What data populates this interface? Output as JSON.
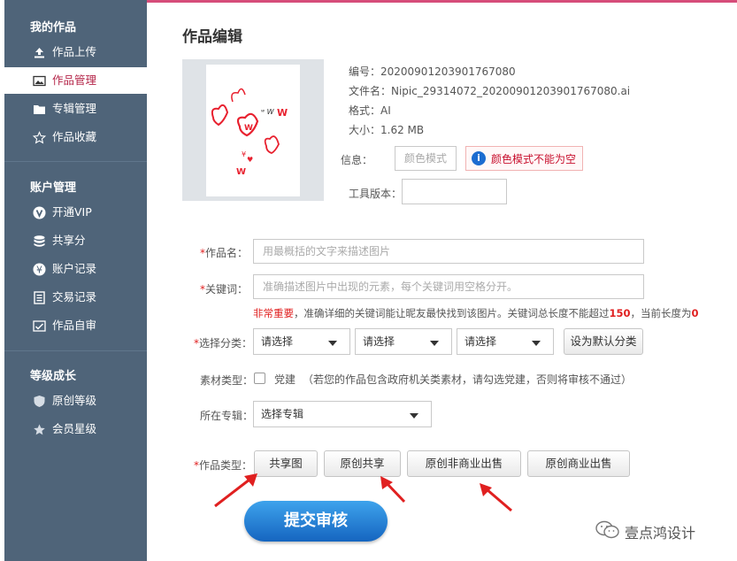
{
  "sidebar": {
    "sections": [
      {
        "title": "我的作品",
        "items": [
          {
            "label": "作品上传",
            "icon": "upload-icon"
          },
          {
            "label": "作品管理",
            "icon": "image-icon",
            "active": true
          },
          {
            "label": "专辑管理",
            "icon": "folder-icon"
          },
          {
            "label": "作品收藏",
            "icon": "star-outline-icon"
          }
        ]
      },
      {
        "title": "账户管理",
        "items": [
          {
            "label": "开通VIP",
            "icon": "vip-icon"
          },
          {
            "label": "共享分",
            "icon": "database-icon"
          },
          {
            "label": "账户记录",
            "icon": "yen-icon"
          },
          {
            "label": "交易记录",
            "icon": "ledger-icon"
          },
          {
            "label": "作品自审",
            "icon": "image-check-icon"
          }
        ]
      },
      {
        "title": "等级成长",
        "items": [
          {
            "label": "原创等级",
            "icon": "shield-icon"
          },
          {
            "label": "会员星级",
            "icon": "star-icon"
          }
        ]
      }
    ]
  },
  "page": {
    "title": "作品编辑"
  },
  "meta": {
    "id": "编号：20200901203901767080",
    "filename": "文件名：Nipic_29314072_20200901203901767080.ai",
    "format": "格式：AI",
    "size": "大小：1.62 MB",
    "info_label": "信息：",
    "color_mode_placeholder": "颜色模式",
    "error_text": "颜色模式不能为空",
    "tool_version_label": "工具版本："
  },
  "form": {
    "name_label": "作品名：",
    "name_placeholder": "用最概括的文字来描述图片",
    "keywords_label": "关键词：",
    "keywords_placeholder": "准确描述图片中出现的元素，每个关键词用空格分开。",
    "hint_important": "非常重要",
    "hint_text": "，准确详细的关键词能让昵友最快找到该图片。关键词总长度不能超过",
    "hint_max": "150",
    "hint_text2": "，当前长度为",
    "hint_current": "0",
    "category_label": "选择分类：",
    "category_selects": [
      "请选择",
      "请选择",
      "请选择"
    ],
    "default_category_button": "设为默认分类",
    "material_label": "素材类型：",
    "material_checkbox_label": "党建",
    "material_note": "（若您的作品包含政府机关类素材，请勾选党建，否则将审核不通过）",
    "album_label": "所在专辑：",
    "album_select": "选择专辑",
    "type_label": "作品类型：",
    "type_buttons": [
      "共享图",
      "原创共享",
      "原创非商业出售",
      "原创商业出售"
    ],
    "submit": "提交审核"
  },
  "watermark": "壹点鸿设计",
  "colors": {
    "sidebar_bg": "#4f6479",
    "accent": "#d64d7a",
    "error": "#c8102e",
    "submit": "#1a75d2",
    "arrow": "#e02020"
  }
}
